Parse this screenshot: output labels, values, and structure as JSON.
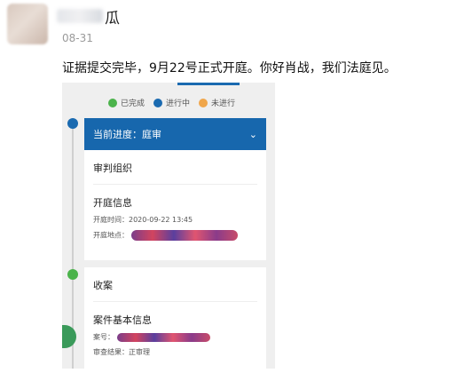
{
  "post": {
    "name_visible": "瓜",
    "date": "08-31",
    "text": "证据提交完毕，9月22号正式开庭。你好肖战，我们法庭见。"
  },
  "screenshot": {
    "legend": [
      {
        "label": "已完成",
        "color": "#4bb34b",
        "icon": "check-circle-icon"
      },
      {
        "label": "进行中",
        "color": "#1a6ab0",
        "icon": "arrow-circle-icon"
      },
      {
        "label": "未进行",
        "color": "#f0a64b",
        "icon": "x-circle-icon"
      }
    ],
    "current_stage": "当前进度：庭审",
    "section_trial_org": "审判组织",
    "section_hearing": "开庭信息",
    "hearing_time_label": "开庭时间：",
    "hearing_time_value": "2020-09-22 13:45",
    "hearing_place_label": "开庭地点：",
    "section_filing": "收案",
    "section_case_info": "案件基本信息",
    "case_no_label": "案号：",
    "review_label": "审查结果：",
    "review_value": "正审理"
  }
}
